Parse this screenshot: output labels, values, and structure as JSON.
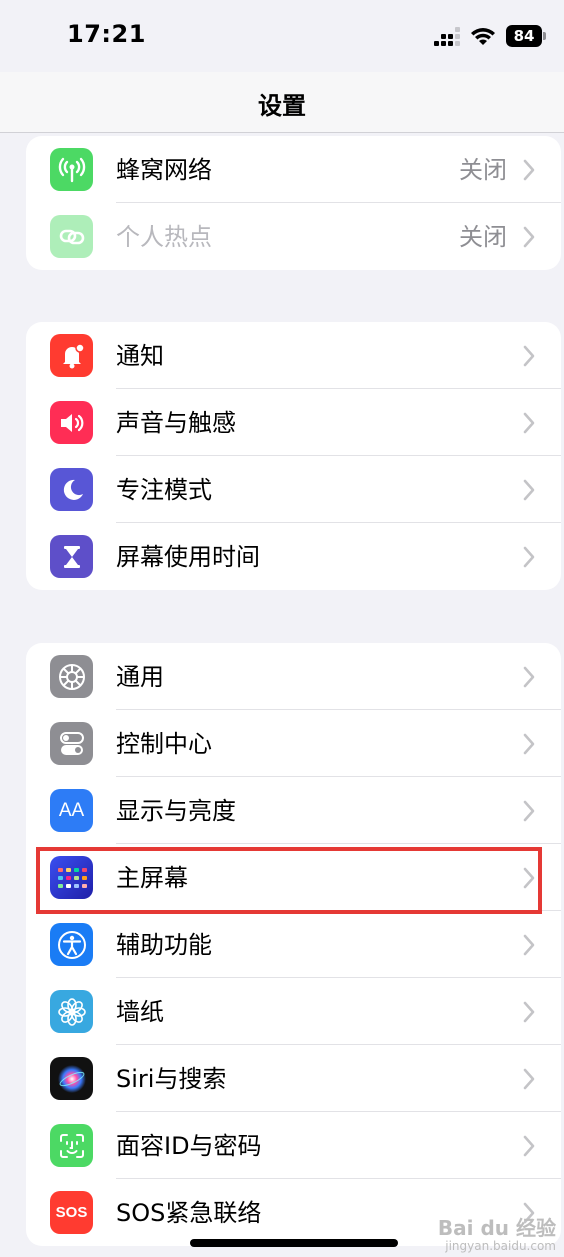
{
  "status_bar": {
    "time": "17:21",
    "battery": "84"
  },
  "nav": {
    "title": "设置"
  },
  "groups": [
    {
      "rows": [
        {
          "label": "蜂窝网络",
          "value": "关闭",
          "icon": "antenna-icon",
          "color": "#4cd964"
        },
        {
          "label": "个人热点",
          "value": "关闭",
          "icon": "hotspot-icon",
          "color": "#4cd964",
          "disabled": true
        }
      ]
    },
    {
      "rows": [
        {
          "label": "通知",
          "icon": "bell-icon",
          "color": "#ff3b30"
        },
        {
          "label": "声音与触感",
          "icon": "speaker-icon",
          "color": "#ff2d55"
        },
        {
          "label": "专注模式",
          "icon": "moon-icon",
          "color": "#5856d6"
        },
        {
          "label": "屏幕使用时间",
          "icon": "hourglass-icon",
          "color": "#5e4fc9"
        }
      ]
    },
    {
      "rows": [
        {
          "label": "通用",
          "icon": "gear-icon",
          "color": "#8e8e93"
        },
        {
          "label": "控制中心",
          "icon": "toggles-icon",
          "color": "#8e8e93"
        },
        {
          "label": "显示与亮度",
          "icon": "text-size-icon",
          "color": "#2d7cf6",
          "glyph": "AA"
        },
        {
          "label": "主屏幕",
          "icon": "home-grid-icon",
          "color": "#2b2ccf"
        },
        {
          "label": "辅助功能",
          "icon": "accessibility-icon",
          "color": "#1a7cf5"
        },
        {
          "label": "墙纸",
          "icon": "flower-icon",
          "color": "#38a8e0"
        },
        {
          "label": "Siri与搜索",
          "icon": "siri-icon",
          "color": "#111111"
        },
        {
          "label": "面容ID与密码",
          "icon": "face-id-icon",
          "color": "#4cd964"
        },
        {
          "label": "SOS紧急联络",
          "icon": "sos-icon",
          "color": "#ff3b30",
          "glyph": "SOS"
        }
      ]
    }
  ],
  "watermark": {
    "line1": "Bai du 经验",
    "line2": "jingyan.baidu.com"
  }
}
